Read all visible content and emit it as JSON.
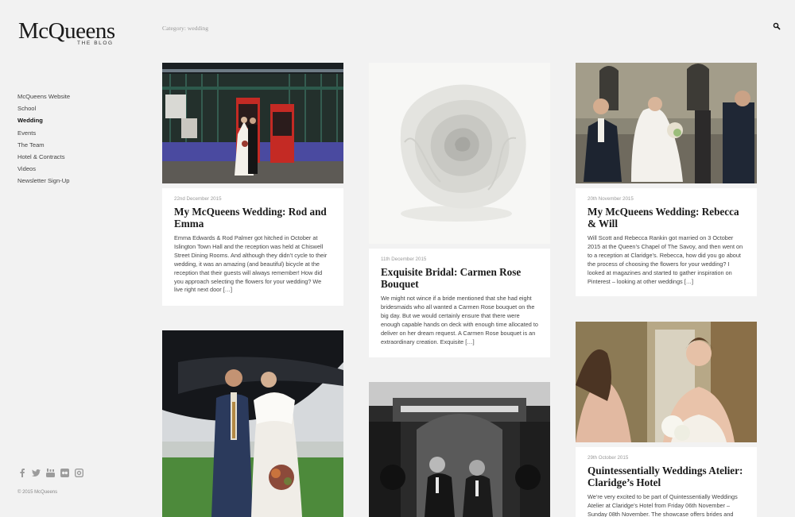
{
  "site": {
    "logo_main": "McQueens",
    "logo_sub": "THE BLOG",
    "category_label": "Category: wedding",
    "copyright": "© 2015 McQueens"
  },
  "nav": {
    "items": [
      {
        "label": "McQueens Website"
      },
      {
        "label": "School"
      },
      {
        "label": "Wedding"
      },
      {
        "label": "Events"
      },
      {
        "label": "The Team"
      },
      {
        "label": "Hotel & Contracts"
      },
      {
        "label": "Videos"
      },
      {
        "label": "Newsletter Sign-Up"
      }
    ],
    "active": "Wedding"
  },
  "social": [
    "facebook-icon",
    "twitter-icon",
    "youtube-icon",
    "flickr-icon",
    "instagram-icon"
  ],
  "posts": [
    {
      "date": "22nd December 2015",
      "title": "My McQueens Wedding: Rod and Emma",
      "excerpt": "Emma Edwards & Rod Palmer got hitched in October at Islington Town Hall and the reception was held at Chiswell Street Dining Rooms. And although they didn’t cycle to their wedding, it was an amazing (and beautiful) bicycle at the reception that their guests will always remember! How did you approach selecting the flowers for your wedding? We live right next door […]",
      "image": "couple-by-red-phone-boxes"
    },
    {
      "date": "11th December 2015",
      "title": "Exquisite Bridal: Carmen Rose Bouquet",
      "excerpt": "We might not wince if a bride mentioned that she had eight bridesmaids who all wanted a Carmen Rose bouquet on the big day. But we would certainly ensure that there were enough capable hands on deck with enough time allocated to deliver on her dream request. A Carmen Rose bouquet is an extraordinary creation. Exquisite […]",
      "image": "white-carmen-rose"
    },
    {
      "date": "20th November 2015",
      "title": "My McQueens Wedding: Rebecca & Will",
      "excerpt": "Will Scott and Rebecca Rankin got married on 3 October 2015 at the Queen’s Chapel of The Savoy, and then went on to a reception at Claridge’s.   Rebecca, how did you go about the process of choosing the flowers for your wedding? I looked at magazines and started to gather inspiration on Pinterest – looking at other weddings […]",
      "image": "couple-leaving-chapel"
    },
    {
      "date": "",
      "title": "",
      "excerpt": "",
      "image": "couple-outdoor-sculpture"
    },
    {
      "date": "",
      "title": "",
      "excerpt": "",
      "image": "grooms-connaught-hotel"
    },
    {
      "date": "29th October 2015",
      "title": "Quintessentially Weddings Atelier: Claridge’s Hotel",
      "excerpt": "We’re very excited to be part of Quintessentially Weddings Atelier at Claridge’s Hotel from Friday 06th November – Sunday 08th November. The showcase offers brides and",
      "image": "bride-in-mirror"
    }
  ]
}
